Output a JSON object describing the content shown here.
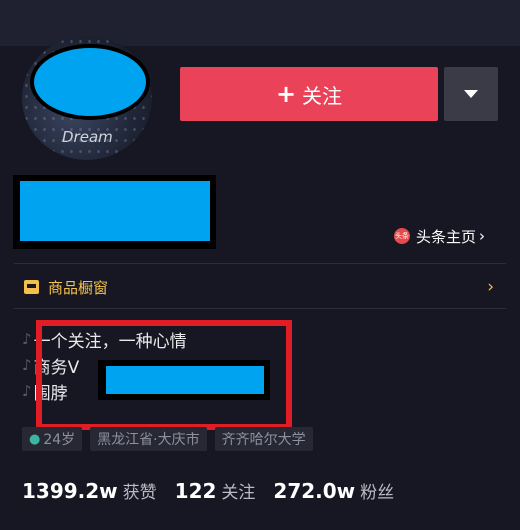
{
  "header": {
    "follow_label": "关注",
    "follow_plus": "+"
  },
  "profile": {
    "avatar_signature": "Dream",
    "toutiao_icon_text": "头条",
    "toutiao_link": "头条主页",
    "chevron": "›"
  },
  "shop": {
    "label": "商品橱窗",
    "arrow": "›"
  },
  "bio": {
    "note_symbol": "♪",
    "lines": [
      "一个关注，一种心情",
      "商务V",
      "围脖"
    ]
  },
  "tags": {
    "age": "24岁",
    "location": "黑龙江省·大庆市",
    "school": "齐齐哈尔大学"
  },
  "stats": {
    "likes_value": "1399.2w",
    "likes_label": "获赞",
    "following_value": "122",
    "following_label": "关注",
    "fans_value": "272.0w",
    "fans_label": "粉丝"
  },
  "colors": {
    "background": "#161722",
    "follow_button": "#ea4258",
    "shop_accent": "#f3c14b",
    "redaction": "#00a3ef",
    "highlight_box": "#e01d25"
  }
}
